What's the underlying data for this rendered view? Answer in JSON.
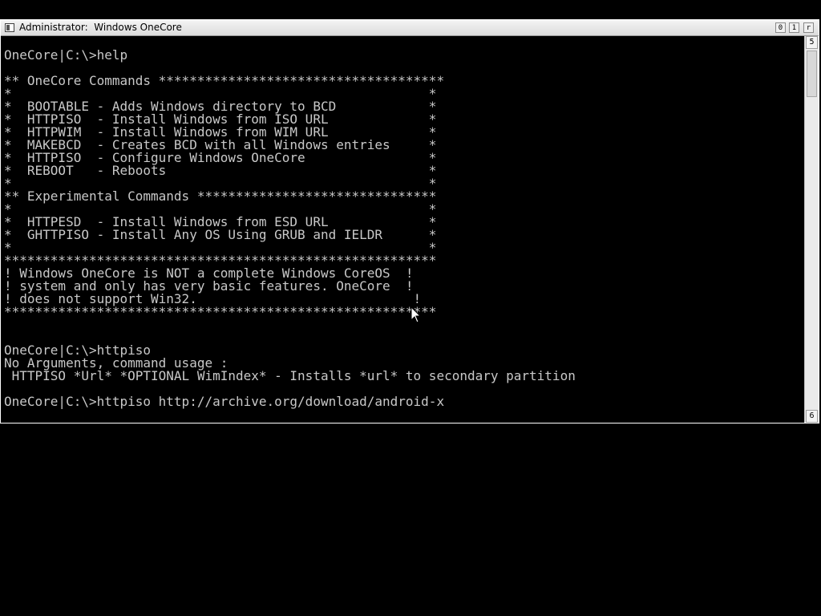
{
  "window": {
    "title": "Administrator:  Windows OneCore",
    "buttons": {
      "minimize": "0",
      "maximize": "1",
      "close": "r"
    }
  },
  "scrollbar": {
    "up_glyph": "5",
    "down_glyph": "6"
  },
  "console": {
    "lines": [
      "",
      "OneCore|C:\\>help",
      "",
      "** OneCore Commands *************************************",
      "*                                                      *",
      "*  BOOTABLE - Adds Windows directory to BCD            *",
      "*  HTTPISO  - Install Windows from ISO URL             *",
      "*  HTTPWIM  - Install Windows from WIM URL             *",
      "*  MAKEBCD  - Creates BCD with all Windows entries     *",
      "*  HTTPISO  - Configure Windows OneCore                *",
      "*  REBOOT   - Reboots                                  *",
      "*                                                      *",
      "** Experimental Commands *******************************",
      "*                                                      *",
      "*  HTTPESD  - Install Windows from ESD URL             *",
      "*  GHTTPISO - Install Any OS Using GRUB and IELDR      *",
      "*                                                      *",
      "********************************************************",
      "! Windows OneCore is NOT a complete Windows CoreOS  !",
      "! system and only has very basic features. OneCore  !",
      "! does not support Win32.                            !",
      "********************************************************",
      "",
      "",
      "OneCore|C:\\>httpiso",
      "No Arguments, command usage :",
      " HTTPISO *Url* *OPTIONAL WimIndex* - Installs *url* to secondary partition",
      "",
      "OneCore|C:\\>httpiso http://archive.org/download/android-x"
    ]
  }
}
